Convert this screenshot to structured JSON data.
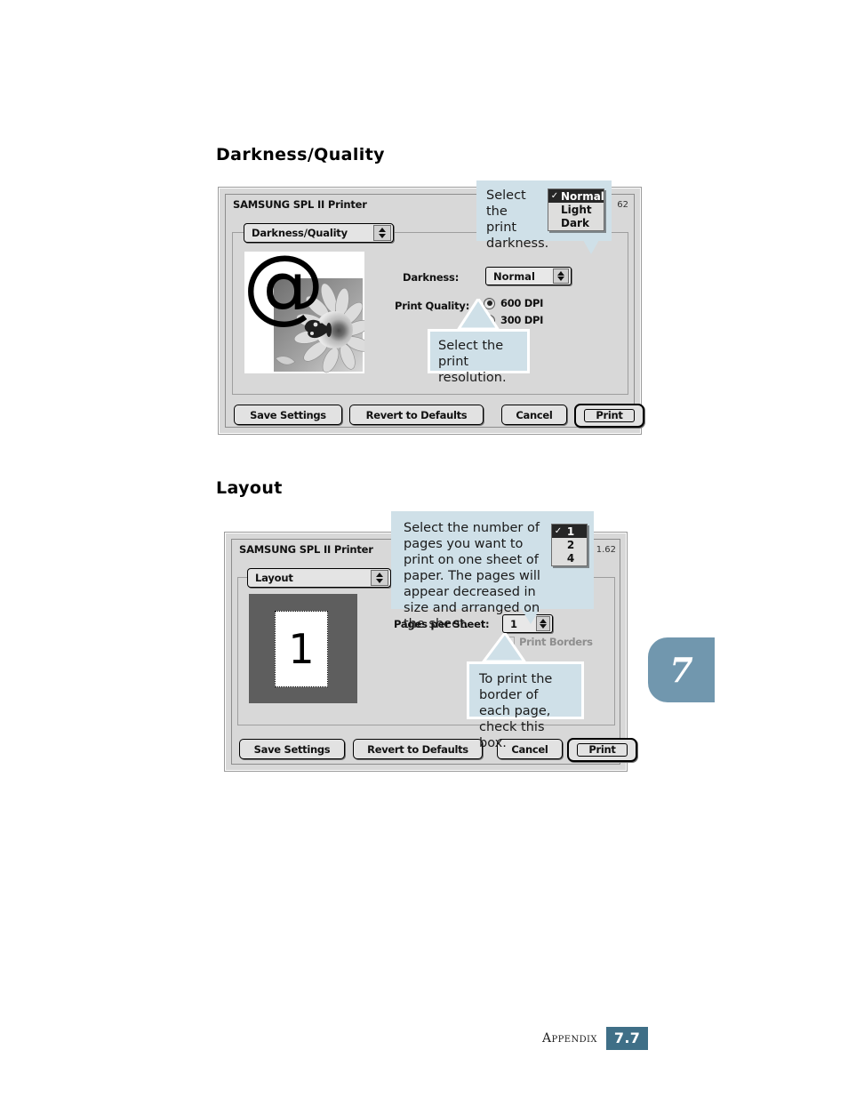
{
  "page": {
    "heading_darkness": "Darkness/Quality",
    "heading_layout": "Layout",
    "footer_label": "Appendix",
    "footer_page": "7.7",
    "chapter_tab": "7"
  },
  "dialog_darkness": {
    "title": "SAMSUNG SPL II Printer",
    "version": "62",
    "panel_popup": "Darkness/Quality",
    "darkness_label": "Darkness:",
    "darkness_value": "Normal",
    "print_quality_label": "Print Quality:",
    "quality_options": [
      {
        "label": "600 DPI",
        "selected": true
      },
      {
        "label": "300 DPI",
        "selected": false
      }
    ],
    "buttons": {
      "save": "Save Settings",
      "revert": "Revert to Defaults",
      "cancel": "Cancel",
      "print": "Print"
    },
    "open_menu": {
      "items": [
        "Normal",
        "Light",
        "Dark"
      ],
      "selected": "Normal",
      "checkmark": "✓"
    },
    "callout_darkness": "Select the print darkness.",
    "callout_resolution": "Select the print resolution."
  },
  "dialog_layout": {
    "title": "SAMSUNG SPL II Printer",
    "version": "1.62",
    "panel_popup": "Layout",
    "pages_per_sheet_label": "Pages per Sheet:",
    "pages_per_sheet_value": "1",
    "print_borders_label": "Print Borders",
    "print_borders_checked": false,
    "preview_page_number": "1",
    "buttons": {
      "save": "Save Settings",
      "revert": "Revert to Defaults",
      "cancel": "Cancel",
      "print": "Print"
    },
    "open_menu": {
      "items": [
        "1",
        "2",
        "4"
      ],
      "selected": "1",
      "checkmark": "✓"
    },
    "callout_pages": "Select the number of pages you want to print on one sheet of paper. The pages will appear decreased in size and arranged on the sheet.",
    "callout_borders": "To print the border of each page, check this box."
  },
  "colors": {
    "callout_bg": "#cfe0e8",
    "dialog_bg": "#d8d8d8",
    "accent": "#3f6f87",
    "tab": "#7197ae"
  }
}
